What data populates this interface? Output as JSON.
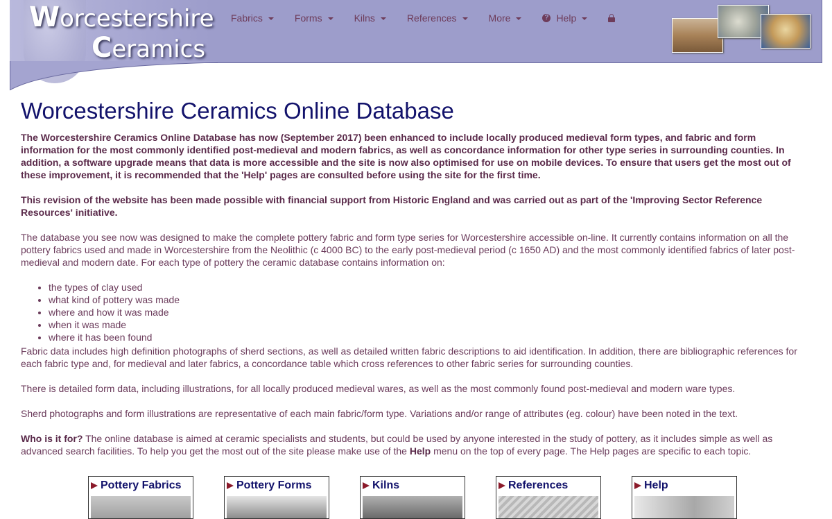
{
  "header": {
    "logo_line1_initial": "W",
    "logo_line1_rest": "orcestershire",
    "logo_line2_initial": "C",
    "logo_line2_rest": "eramics",
    "background_color": "#9d9dcb",
    "nav_color": "#6e3c5a"
  },
  "nav": {
    "items": [
      {
        "label": "Fabrics"
      },
      {
        "label": "Forms"
      },
      {
        "label": "Kilns"
      },
      {
        "label": "References"
      },
      {
        "label": "More"
      },
      {
        "label": "Help",
        "icon": "question-circle-icon"
      }
    ],
    "lock_icon": "lock-icon"
  },
  "main": {
    "title": "Worcestershire Ceramics Online Database",
    "bold_para1": "The Worcestershire Ceramics Online Database has now (September 2017) been enhanced to include locally produced medieval form types, and fabric and form information for the most commonly identified post-medieval and modern fabrics, as well as concordance information for other type series in surrounding counties. In addition,  a software upgrade means that data is more accessible and the site is now also optimised for use on mobile devices. To ensure that users get the most out of these improvement, it is recommended that the 'Help' pages are consulted before using the site for the first time.",
    "bold_para2": "This revision of the website has been made possible with financial support from Historic England and was carried out as part of the 'Improving Sector Reference Resources' initiative.",
    "intro": "The database you see now was designed to make the complete pottery fabric and form type series for Worcestershire accessible on-line. It currently contains information on all the pottery fabrics used and made in Worcestershire from the Neolithic (c 4000 BC) to the early post-medieval period (c 1650 AD) and the most commonly identified fabrics of later post-medieval and modern date.   For each type of pottery the ceramic database contains information on:",
    "bullets": [
      "the types of clay used",
      "what kind of pottery was made",
      "where and how it was made",
      "when it was made",
      "where it has been found"
    ],
    "fabric_para": "Fabric data includes high definition photographs of sherd sections, as well as detailed written fabric descriptions to aid identification. In addition, there are bibliographic references for each fabric type and, for medieval and later fabrics, a concordance table which cross references to other fabric series for surrounding counties.",
    "form_para": "There is detailed form data, including illustrations, for all locally produced medieval wares, as well as the most commonly found post-medieval and modern ware types.",
    "sherd_para": "Sherd photographs and form illustrations are representative of each main fabric/form type. Variations and/or range of attributes (eg. colour) have been noted in the text.",
    "who_label": "Who is it for?",
    "who_text_a": "   The online database is aimed at ceramic specialists and students, but could be used by anyone interested in the study of pottery, as it includes simple as well as advanced search facilities. To help you get the most out of the site please make use of the ",
    "who_help_word": "Help",
    "who_text_b": " menu on the top of every page. The Help pages are specific to each topic."
  },
  "tiles": [
    {
      "label": "Pottery Fabrics"
    },
    {
      "label": "Pottery Forms"
    },
    {
      "label": "Kilns"
    },
    {
      "label": "References"
    },
    {
      "label": "Help"
    }
  ],
  "colors": {
    "title": "#12126b",
    "body_text": "#6a3a5a",
    "arrow": "#8b1a2a"
  }
}
